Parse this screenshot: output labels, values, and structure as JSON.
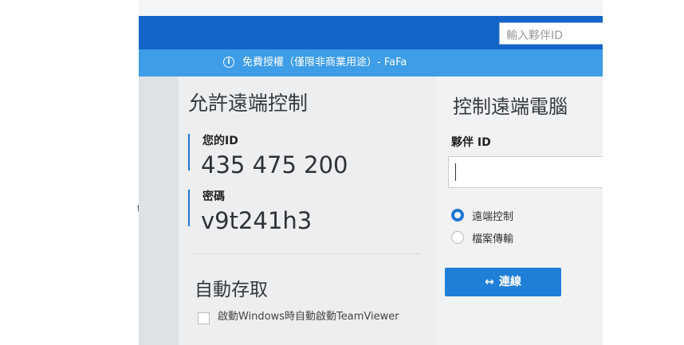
{
  "search": {
    "placeholder": "輸入夥伴ID"
  },
  "license_bar": {
    "icon": "info-icon",
    "text": "免費授權（僅限非商業用途）- FaFa"
  },
  "allow_remote": {
    "heading": "允許遠端控制",
    "id_label": "您的ID",
    "id_value": "435 475 200",
    "password_label": "密碼",
    "password_value": "v9t241h3"
  },
  "auto_access": {
    "heading": "自動存取",
    "checkbox_label": "啟動Windows時自動啟動TeamViewer",
    "checked": false
  },
  "control_remote": {
    "heading": "控制遠端電腦",
    "partner_label": "夥伴 ID",
    "partner_value": "",
    "options": [
      {
        "label": "遠端控制",
        "selected": true
      },
      {
        "label": "檔案傳輸",
        "selected": false
      }
    ],
    "connect_label": "連線",
    "connect_icon": "swap-arrows-icon"
  },
  "stray": {
    "text": "t"
  },
  "colors": {
    "titlebar": "#1565c8",
    "license_bar": "#3d9de6",
    "accent": "#1d74d1",
    "button": "#1f7fd6"
  }
}
